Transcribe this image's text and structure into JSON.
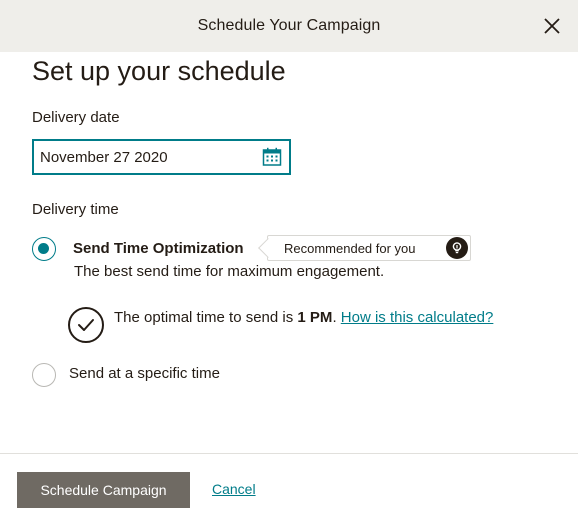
{
  "modal": {
    "title": "Schedule Your Campaign"
  },
  "page": {
    "title": "Set up your schedule"
  },
  "delivery_date": {
    "label": "Delivery date",
    "value": "November 27 2020"
  },
  "delivery_time": {
    "label": "Delivery time",
    "selected": "sto",
    "sto": {
      "title": "Send Time Optimization",
      "badge": "Recommended for you",
      "description": "The best send time for maximum engagement.",
      "optimal_prefix": "The optimal time to send is ",
      "optimal_time": "1 PM",
      "optimal_suffix": ". ",
      "link": "How is this calculated?"
    },
    "specific": {
      "label": "Send at a specific time"
    }
  },
  "footer": {
    "primary_label": "Schedule Campaign",
    "cancel_label": "Cancel"
  },
  "icons": {
    "close": "close-icon",
    "calendar": "calendar-icon",
    "lightbulb": "lightbulb-icon",
    "check": "check-circle-icon"
  },
  "colors": {
    "accent": "#007c89",
    "header_bg": "#efeeea",
    "primary_button": "#6f6a63",
    "text": "#241c15"
  }
}
